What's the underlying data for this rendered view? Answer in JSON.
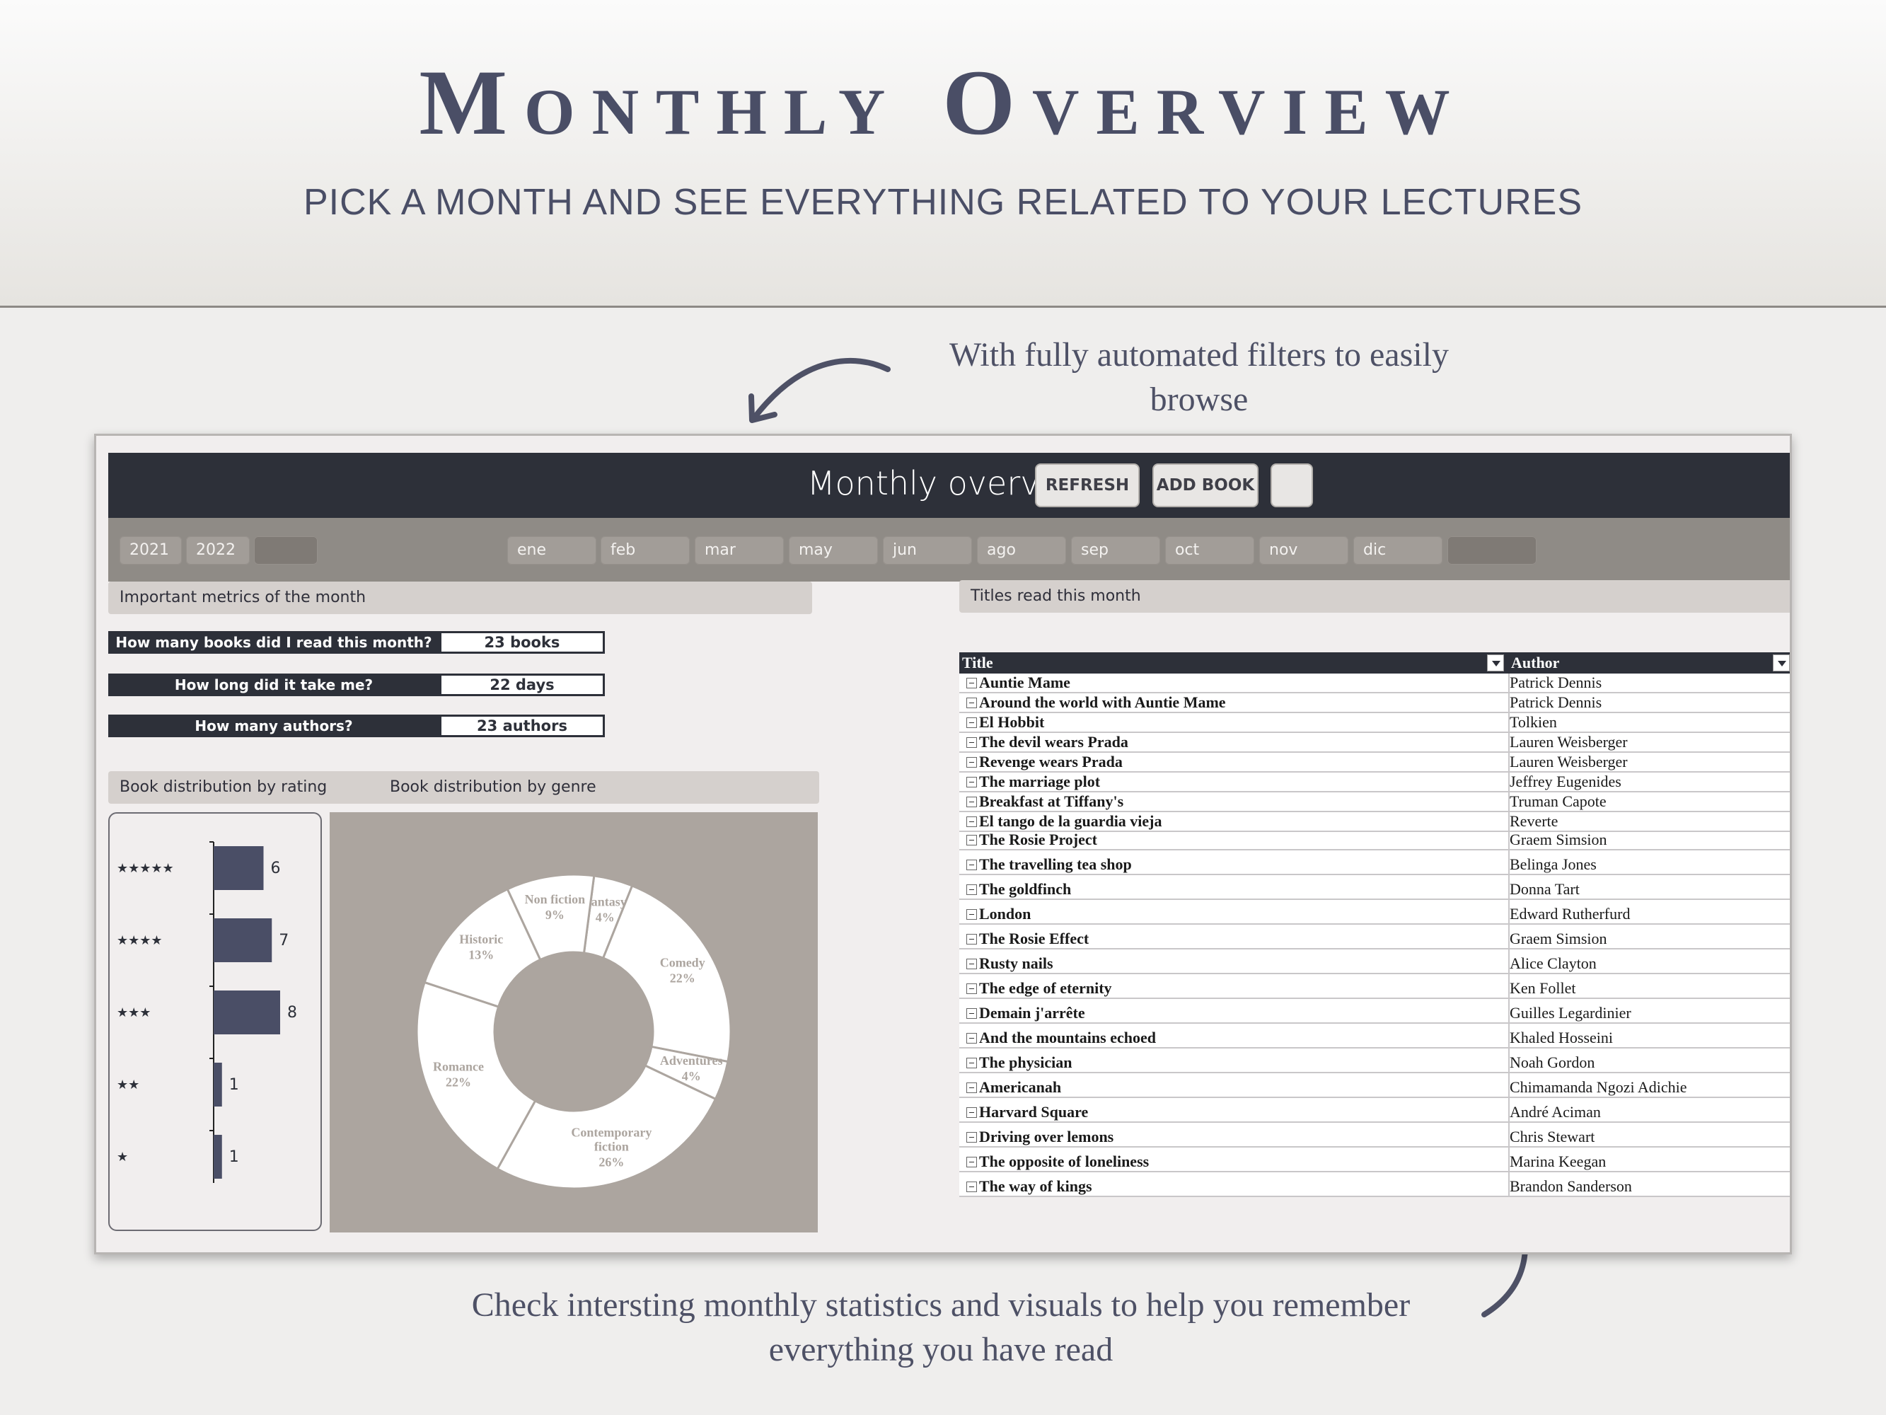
{
  "banner": {
    "title": "Monthly Overview",
    "subtitle": "PICK A MONTH AND SEE EVERYTHING RELATED TO YOUR LECTURES"
  },
  "notes": {
    "top": "With fully automated filters to easily browse",
    "bottom": "Check intersting monthly statistics and visuals to help you remember everything you have read"
  },
  "dashboard": {
    "title": "Monthly overview",
    "buttons": {
      "refresh": "REFRESH",
      "add_book": "ADD BOOK"
    },
    "years": [
      "2021",
      "2022",
      ""
    ],
    "months": [
      "ene",
      "feb",
      "mar",
      "may",
      "jun",
      "ago",
      "sep",
      "oct",
      "nov",
      "dic",
      ""
    ],
    "metrics_header": "Important metrics of the month",
    "metrics": [
      {
        "question": "How many books did I read this month?",
        "answer": "23 books"
      },
      {
        "question": "How long did it take me?",
        "answer": "22 days"
      },
      {
        "question": "How many authors?",
        "answer": "23 authors"
      }
    ],
    "dist_header": {
      "rating": "Book distribution by rating",
      "genre": "Book distribution by genre"
    },
    "titles_header": "Titles read this month",
    "table": {
      "col_title": "Title",
      "col_author": "Author",
      "rows": [
        {
          "title": "Auntie Mame",
          "author": "Patrick Dennis"
        },
        {
          "title": "Around the world with Auntie Mame",
          "author": "Patrick Dennis"
        },
        {
          "title": "El Hobbit",
          "author": "Tolkien"
        },
        {
          "title": "The devil wears Prada",
          "author": "Lauren Weisberger"
        },
        {
          "title": "Revenge wears Prada",
          "author": "Lauren Weisberger"
        },
        {
          "title": "The marriage plot",
          "author": "Jeffrey Eugenides"
        },
        {
          "title": "Breakfast at Tiffany's",
          "author": "Truman Capote"
        },
        {
          "title": "El tango de la guardia vieja",
          "author": "Reverte"
        },
        {
          "title": "The Rosie Project",
          "author": "Graem Simsion"
        },
        {
          "title": "The travelling tea shop",
          "author": "Belinga Jones"
        },
        {
          "title": "The goldfinch",
          "author": "Donna Tart"
        },
        {
          "title": "London",
          "author": "Edward Rutherfurd"
        },
        {
          "title": "The Rosie Effect",
          "author": "Graem Simsion"
        },
        {
          "title": "Rusty nails",
          "author": "Alice Clayton"
        },
        {
          "title": "The edge of eternity",
          "author": "Ken Follet"
        },
        {
          "title": "Demain j'arrête",
          "author": "Guilles Legardinier"
        },
        {
          "title": "And the mountains echoed",
          "author": "Khaled Hosseini"
        },
        {
          "title": "The physician",
          "author": "Noah Gordon"
        },
        {
          "title": "Americanah",
          "author": "Chimamanda Ngozi Adichie"
        },
        {
          "title": "Harvard Square",
          "author": "André Aciman"
        },
        {
          "title": "Driving over lemons",
          "author": "Chris Stewart"
        },
        {
          "title": "The opposite of loneliness",
          "author": "Marina Keegan"
        },
        {
          "title": "The way of kings",
          "author": "Brandon Sanderson"
        }
      ]
    },
    "colors": {
      "header": "#2d3039",
      "bar": "#4a4e66",
      "filter_bar": "#8f8b86",
      "donut_bg": "#aca59f"
    }
  },
  "chart_data": [
    {
      "type": "bar",
      "orientation": "horizontal",
      "categories": [
        "★★★★★",
        "★★★★",
        "★★★",
        "★★",
        "★"
      ],
      "values": [
        6,
        7,
        8,
        1,
        1
      ],
      "xlim": [
        0,
        8
      ]
    },
    {
      "type": "pie",
      "hole": true,
      "slices": [
        {
          "label": "Fantasy",
          "pct_label": "4%",
          "value": 4
        },
        {
          "label": "Comedy",
          "pct_label": "22%",
          "value": 22
        },
        {
          "label": "Adventures",
          "pct_label": "4%",
          "value": 4
        },
        {
          "label": "Contemporary fiction",
          "pct_label": "26%",
          "value": 26
        },
        {
          "label": "Romance",
          "pct_label": "22%",
          "value": 22
        },
        {
          "label": "Historic",
          "pct_label": "13%",
          "value": 13
        },
        {
          "label": "Non fiction",
          "pct_label": "9%",
          "value": 9
        }
      ]
    }
  ]
}
